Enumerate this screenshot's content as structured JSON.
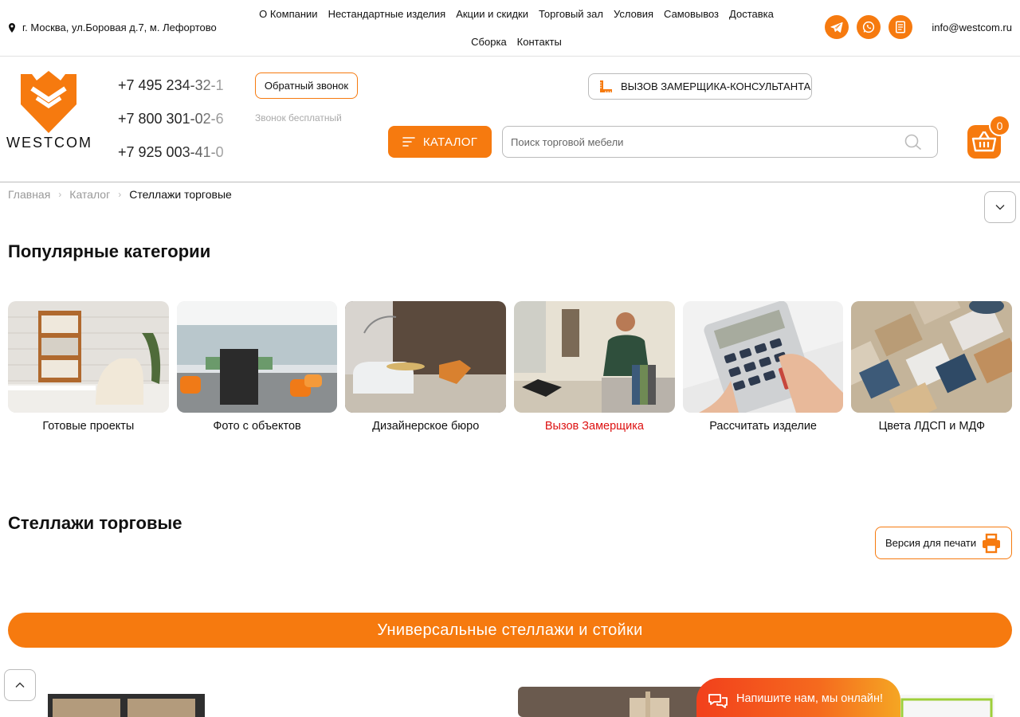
{
  "topbar": {
    "address": "г. Москва, ул.Боровая д.7, м. Лефортово",
    "nav": [
      "О Компании",
      "Нестандартные изделия",
      "Акции и скидки",
      "Торговый зал",
      "Условия",
      "Самовывоз",
      "Доставка",
      "Сборка",
      "Контакты"
    ],
    "email": "info@westcom.ru"
  },
  "header": {
    "logo_text": "WESTCOM",
    "phones": [
      "+7 495 234-32-1",
      "+7 800 301-02-6",
      "+7 925 003-41-0"
    ],
    "callback_label": "Обратный звонок",
    "free_call_note": "Звонок бесплатный",
    "measure_label": "ВЫЗОВ ЗАМЕРЩИКА-КОНСУЛЬТАНТА",
    "catalog_label": "КАТАЛОГ",
    "search_placeholder": "Поиск торговой мебели",
    "cart_count": "0"
  },
  "breadcrumb": [
    "Главная",
    "Каталог",
    "Стеллажи торговые"
  ],
  "popular": {
    "title": "Популярные категории",
    "items": [
      {
        "label": "Готовые проекты"
      },
      {
        "label": "Фото с объектов"
      },
      {
        "label": "Дизайнерское бюро"
      },
      {
        "label": "Вызов Замерщика"
      },
      {
        "label": "Рассчитать изделие"
      },
      {
        "label": "Цвета ЛДСП и МДФ"
      }
    ]
  },
  "section": {
    "title": "Стеллажи торговые",
    "print_label": "Версия для печати",
    "banner": "Универсальные стеллажи и стойки"
  },
  "chat": {
    "label": "Напишите нам, мы онлайн!"
  },
  "colors": {
    "accent": "#f67a0f",
    "highlight_red": "#d11111"
  }
}
